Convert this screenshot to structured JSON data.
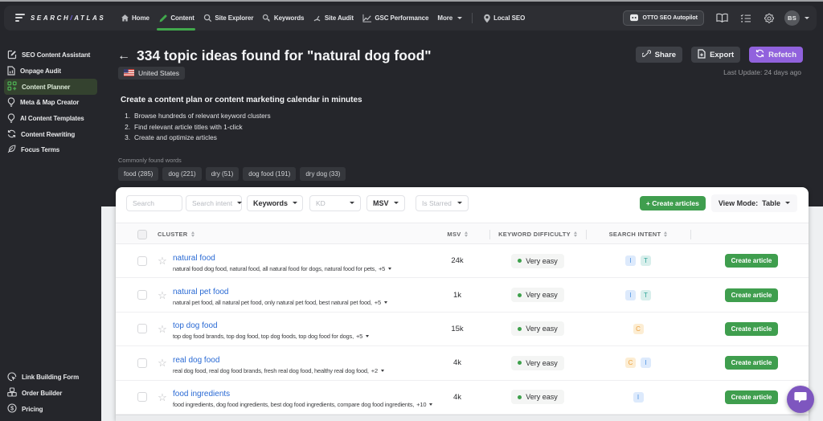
{
  "topbar": {
    "logo": {
      "part1": "SEARCH",
      "slash": "/",
      "part2": "ATLAS"
    },
    "nav": [
      {
        "label": "Home"
      },
      {
        "label": "Content"
      },
      {
        "label": "Site Explorer"
      },
      {
        "label": "Keywords"
      },
      {
        "label": "Site Audit"
      },
      {
        "label": "GSC Performance"
      },
      {
        "label": "More"
      },
      {
        "label": "Local SEO"
      }
    ],
    "otto_button": "OTTO SEO Autopilot",
    "avatar_initials": "BS"
  },
  "sidebar": {
    "items": [
      {
        "label": "SEO Content Assistant"
      },
      {
        "label": "Onpage Audit"
      },
      {
        "label": "Content Planner"
      },
      {
        "label": "Meta & Map Creator"
      },
      {
        "label": "AI Content Templates"
      },
      {
        "label": "Content Rewriting"
      },
      {
        "label": "Focus Terms"
      }
    ],
    "bottom_items": [
      {
        "label": "Link Building Form"
      },
      {
        "label": "Order Builder"
      },
      {
        "label": "Pricing"
      }
    ]
  },
  "header": {
    "back_arrow": "←",
    "title": "334 topic ideas found for \"natural dog food\"",
    "country": "United States",
    "share_label": "Share",
    "export_label": "Export",
    "refetch_label": "Refetch",
    "last_update": "Last Update: 24 days ago"
  },
  "intro": {
    "heading": "Create a content plan or content marketing calendar in minutes",
    "steps": [
      {
        "num": "1.",
        "text": "Browse hundreds of relevant keyword clusters"
      },
      {
        "num": "2.",
        "text": "Find relevant article titles with 1-click"
      },
      {
        "num": "3.",
        "text": "Create and optimize articles"
      }
    ],
    "common_words_label": "Commonly found words",
    "word_chips": [
      {
        "label": "food (285)"
      },
      {
        "label": "dog (221)"
      },
      {
        "label": "dry (51)"
      },
      {
        "label": "dog food (191)"
      },
      {
        "label": "dry dog (33)"
      }
    ]
  },
  "filters": {
    "search_placeholder": "Search",
    "search_intent": "Search intent",
    "keywords": "Keywords",
    "kd": "KD",
    "msv": "MSV",
    "is_starred": "Is Starred",
    "create_articles_label": "+ Create articles",
    "view_mode_label": "View Mode:",
    "view_mode_value": "Table"
  },
  "table": {
    "headers": {
      "cluster": "CLUSTER",
      "msv": "MSV",
      "kd": "KEYWORD DIFFICULTY",
      "intent": "SEARCH INTENT"
    },
    "rows": [
      {
        "cluster": "natural food",
        "keywords": "natural food dog food, natural food, all natural food for dogs, natural food for pets,",
        "more": "+5",
        "msv": "24k",
        "kd": "Very easy",
        "intents": [
          "I",
          "T"
        ],
        "action": "Create article"
      },
      {
        "cluster": "natural pet food",
        "keywords": "natural pet food, all natural pet food, only natural pet food, best natural pet food,",
        "more": "+5",
        "msv": "1k",
        "kd": "Very easy",
        "intents": [
          "I",
          "T"
        ],
        "action": "Create article"
      },
      {
        "cluster": "top dog food",
        "keywords": "top dog food brands, top dog food, top dog foods, top dog food for dogs,",
        "more": "+5",
        "msv": "15k",
        "kd": "Very easy",
        "intents": [
          "C"
        ],
        "action": "Create article"
      },
      {
        "cluster": "real dog food",
        "keywords": "real dog food, real dog food brands, fresh real dog food, healthy real dog food,",
        "more": "+2",
        "msv": "4k",
        "kd": "Very easy",
        "intents": [
          "C",
          "I"
        ],
        "action": "Create article"
      },
      {
        "cluster": "food ingredients",
        "keywords": "food ingredients, dog food ingredients, best dog food ingredients, compare dog food ingredients,",
        "more": "+10",
        "msv": "4k",
        "kd": "Very easy",
        "intents": [
          "I"
        ],
        "action": "Create article"
      }
    ]
  },
  "colors": {
    "accent_green": "#3f9e4e",
    "purple": "#9162dd",
    "link_blue": "#2a6ad4",
    "dark_bg": "#1e2023"
  }
}
